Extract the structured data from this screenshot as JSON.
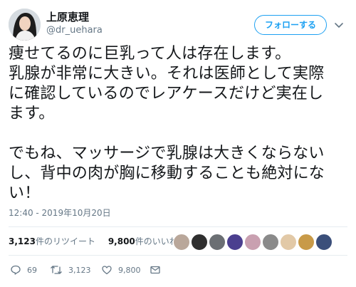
{
  "user": {
    "display_name": "上原恵理",
    "handle": "@dr_uehara"
  },
  "follow_label": "フォローする",
  "tweet_lines": [
    "痩せてるのに巨乳って人は存在します。",
    "乳腺が非常に大きい。それは医師として実際",
    "に確認しているのでレアケースだけど実在し",
    "ます。",
    "",
    "でもね、マッサージで乳腺は大きくならない",
    "し、背中の肉が胸に移動することも絶対にな",
    "い！"
  ],
  "timestamp": "12:40 - 2019年10月20日",
  "stats": {
    "retweets_count": "3,123",
    "retweets_label": "件のリツイート",
    "likes_count": "9,800",
    "likes_label": "件のいいね"
  },
  "likers": [
    {
      "icon": "avatar",
      "color": "#b9a79a"
    },
    {
      "icon": "avatar",
      "color": "#2f2f2f"
    },
    {
      "icon": "avatar",
      "color": "#6b6f73"
    },
    {
      "icon": "avatar",
      "color": "#4b3f8f"
    },
    {
      "icon": "avatar",
      "color": "#c9a0b0"
    },
    {
      "icon": "avatar",
      "color": "#8a8a8a"
    },
    {
      "icon": "avatar",
      "color": "#e2c9a7"
    },
    {
      "icon": "avatar",
      "color": "#c89a48"
    },
    {
      "icon": "avatar",
      "color": "#3b4f7a"
    }
  ],
  "actions": {
    "reply_count": "69",
    "retweet_count": "3,123",
    "like_count": "9,800"
  },
  "colors": {
    "accent": "#1da1f2",
    "text": "#14171a",
    "muted": "#657786",
    "divider": "#e6ecf0"
  }
}
